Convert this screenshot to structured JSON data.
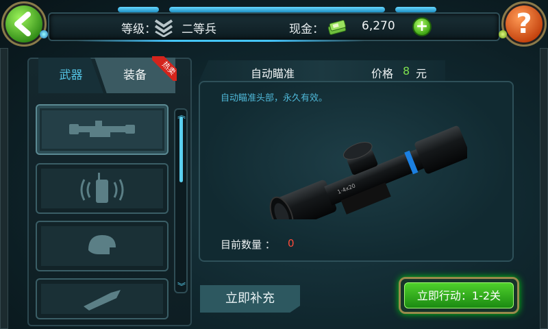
{
  "header": {
    "rank_label": "等级：",
    "rank_name": "二等兵",
    "cash_label": "现金：",
    "cash_value": "6,270",
    "add_cash_label": "+"
  },
  "buttons": {
    "back_icon": "back-arrow-icon",
    "help_label": "?",
    "refill_label": "立即补充",
    "action_label": "立即行动：1-2关"
  },
  "tabs": [
    {
      "label": "武器",
      "selected": false
    },
    {
      "label": "装备",
      "selected": true,
      "badge": "热卖"
    }
  ],
  "equipment_list": [
    {
      "icon": "scope-icon",
      "selected": true
    },
    {
      "icon": "walkie-talkie-icon",
      "selected": false
    },
    {
      "icon": "helmet-icon",
      "selected": false
    },
    {
      "icon": "bullet-icon",
      "selected": false
    }
  ],
  "detail": {
    "title": "自动瞄准",
    "price_label": "价格",
    "price_value": "8",
    "price_unit": "元",
    "description": "自动瞄准头部，永久有效。",
    "quantity_label": "目前数量 ：",
    "quantity_value": "0",
    "image": "rifle-scope-image"
  },
  "colors": {
    "accent_cyan": "#5ad0f0",
    "price_green": "#7ee04e",
    "quantity_red": "#ff4b3a",
    "action_green": "#3fc122"
  }
}
